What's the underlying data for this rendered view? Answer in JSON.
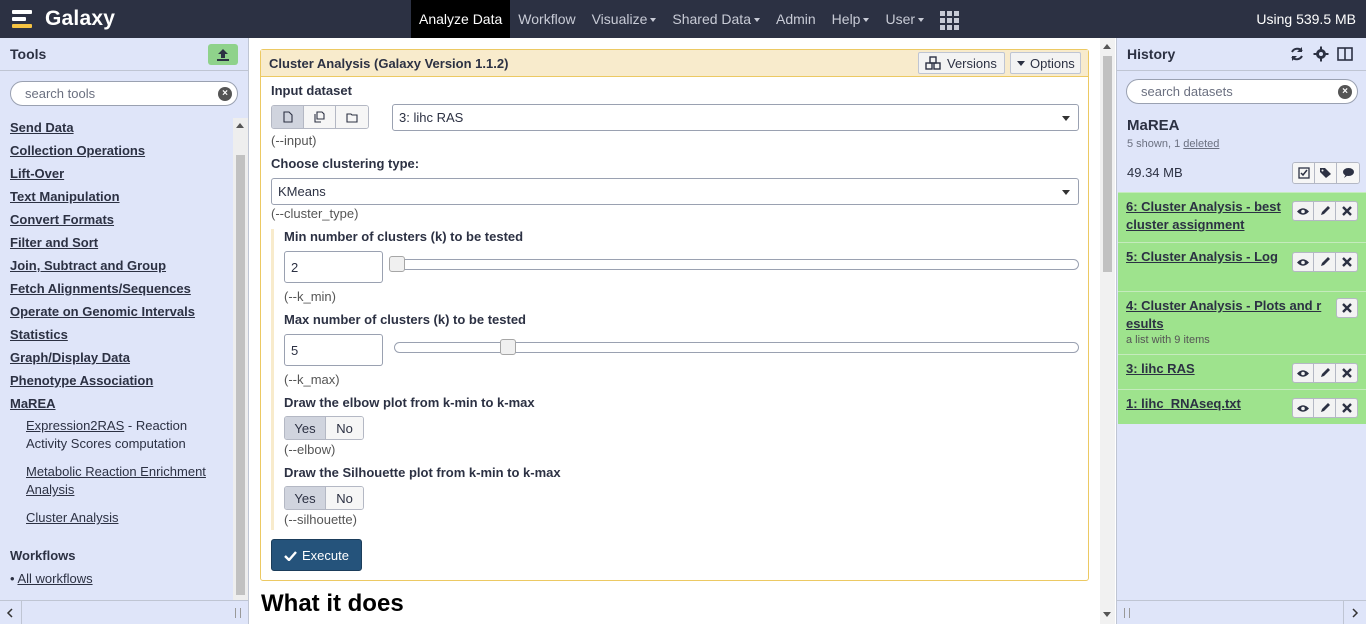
{
  "masthead": {
    "brand": "Galaxy",
    "nav": [
      {
        "label": "Analyze Data",
        "active": true,
        "caret": false
      },
      {
        "label": "Workflow",
        "active": false,
        "caret": false
      },
      {
        "label": "Visualize",
        "active": false,
        "caret": true
      },
      {
        "label": "Shared Data",
        "active": false,
        "caret": true
      },
      {
        "label": "Admin",
        "active": false,
        "caret": false
      },
      {
        "label": "Help",
        "active": false,
        "caret": true
      },
      {
        "label": "User",
        "active": false,
        "caret": true
      }
    ],
    "quota": "Using 539.5 MB"
  },
  "tools": {
    "title": "Tools",
    "search_placeholder": "search tools",
    "sections": [
      "Send Data",
      "Collection Operations",
      "Lift-Over",
      "Text Manipulation",
      "Convert Formats",
      "Filter and Sort",
      "Join, Subtract and Group",
      "Fetch Alignments/Sequences",
      "Operate on Genomic Intervals",
      "Statistics",
      "Graph/Display Data",
      "Phenotype Association",
      "MaREA"
    ],
    "marea_tools": [
      {
        "name": "Expression2RAS",
        "desc": " - Reaction Activity Scores computation"
      },
      {
        "name": "Metabolic Reaction Enrichment Analysis",
        "desc": ""
      },
      {
        "name": "Cluster Analysis",
        "desc": ""
      }
    ],
    "workflows_title": "Workflows",
    "all_workflows": "All workflows"
  },
  "form": {
    "title": "Cluster Analysis (Galaxy Version 1.1.2)",
    "versions_label": "Versions",
    "options_label": "Options",
    "input_label": "Input dataset",
    "input_value": "3: lihc RAS",
    "input_help": "(--input)",
    "cluster_type_label": "Choose clustering type:",
    "cluster_type_value": "KMeans",
    "cluster_type_help": "(--cluster_type)",
    "kmin_label": "Min number of clusters (k) to be tested",
    "kmin_value": "2",
    "kmin_help": "(--k_min)",
    "kmax_label": "Max number of clusters (k) to be tested",
    "kmax_value": "5",
    "kmax_help": "(--k_max)",
    "elbow_label": "Draw the elbow plot from k-min to k-max",
    "elbow_help": "(--elbow)",
    "silhouette_label": "Draw the Silhouette plot from k-min to k-max",
    "silhouette_help": "(--silhouette)",
    "yes_label": "Yes",
    "no_label": "No",
    "execute_label": "Execute",
    "what_it_does": "What it does"
  },
  "history": {
    "title": "History",
    "search_placeholder": "search datasets",
    "name": "MaREA",
    "shown": "5 shown, 1 ",
    "deleted": "deleted",
    "size": "49.34 MB",
    "datasets": [
      {
        "title": "6: Cluster Analysis - best cluster assignment",
        "sub": ""
      },
      {
        "title": "5: Cluster Analysis - Log",
        "sub": ""
      },
      {
        "title": "4: Cluster Analysis - Plots and results",
        "sub": "a list with 9 items"
      },
      {
        "title": "3: lihc RAS",
        "sub": ""
      },
      {
        "title": "1: lihc_RNAseq.txt",
        "sub": ""
      }
    ]
  },
  "colors": {
    "masthead": "#2c3143",
    "panel": "#dfe5f9",
    "dataset_ok": "#9ee38d",
    "form_header": "#f8ebcc",
    "execute": "#25537b"
  }
}
